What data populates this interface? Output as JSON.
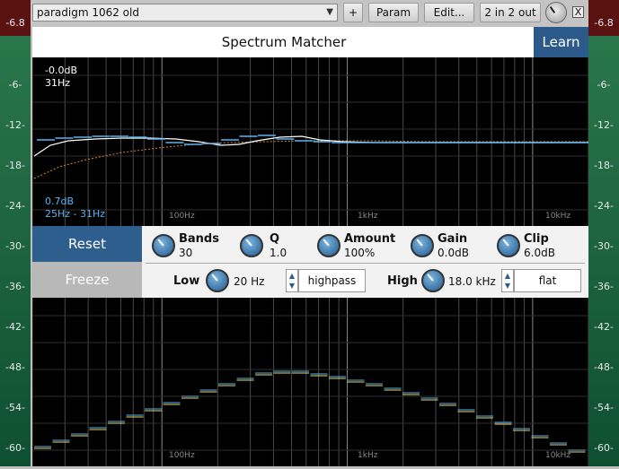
{
  "toolbar": {
    "preset": "paradigm 1062 old",
    "add_label": "+",
    "param_label": "Param",
    "edit_label": "Edit...",
    "io_label": "2 in 2 out",
    "close_label": "X"
  },
  "meters": {
    "left_top": "-6.8",
    "right_top": "-6.8",
    "scale": [
      "-6-",
      "-12-",
      "-18-",
      "-24-",
      "-30-",
      "-36-",
      "-42-",
      "-48-",
      "-54-",
      "-60-"
    ]
  },
  "plugin": {
    "title": "Spectrum Matcher",
    "learn_label": "Learn"
  },
  "graph_top": {
    "readout_db": "-0.0dB",
    "readout_hz": "31Hz",
    "band_db": "0.7dB",
    "band_range": "25Hz - 31Hz",
    "freq_labels": [
      "100Hz",
      "1kHz",
      "10kHz"
    ]
  },
  "graph_bottom": {
    "freq_labels": [
      "100Hz",
      "1kHz",
      "10kHz"
    ]
  },
  "controls": {
    "reset_label": "Reset",
    "freeze_label": "Freeze",
    "bands": {
      "label": "Bands",
      "value": "30"
    },
    "q": {
      "label": "Q",
      "value": "1.0"
    },
    "amount": {
      "label": "Amount",
      "value": "100%"
    },
    "gain": {
      "label": "Gain",
      "value": "0.0dB"
    },
    "clip": {
      "label": "Clip",
      "value": "6.0dB"
    },
    "low": {
      "label": "Low",
      "value": "20 Hz",
      "filter": "highpass"
    },
    "high": {
      "label": "High",
      "value": "18.0 kHz",
      "filter": "flat"
    }
  },
  "colors": {
    "accent": "#2c5a8a",
    "meter_green": "#1d6a44",
    "meter_red": "#5a1210",
    "curve_white": "#ffffff",
    "curve_blue": "#5ab4f0",
    "curve_orange": "#d08a3a",
    "curve_yellow": "#e8d870"
  }
}
